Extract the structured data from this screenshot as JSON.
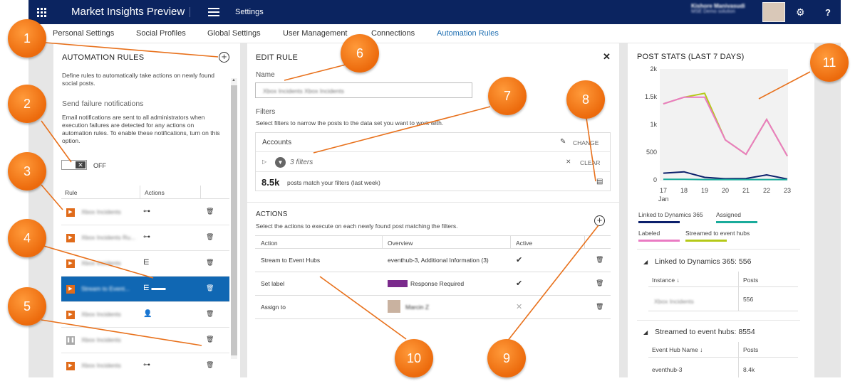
{
  "topbar": {
    "app_title": "Market Insights Preview",
    "section": "Settings",
    "user_name": "Kishore Manivasudi",
    "user_org": "MSE Demo solution"
  },
  "tabs": [
    "Personal Settings",
    "Social Profiles",
    "Global Settings",
    "User Management",
    "Connections",
    "Automation Rules"
  ],
  "automation": {
    "title": "AUTOMATION RULES",
    "description": "Define rules to automatically take actions on newly found social posts.",
    "failure_title": "Send failure notifications",
    "failure_desc": "Email notifications are sent to all administrators when execution failures are detected for any actions on automation rules. To enable these notifications, turn on this option.",
    "toggle_state": "OFF",
    "col_rule": "Rule",
    "col_actions": "Actions",
    "rules": [
      {
        "name": "Xbox Incidents",
        "action": "⊶"
      },
      {
        "name": "Xbox Incidents Ru...",
        "action": "⊶"
      },
      {
        "name": "Xbox Incidents",
        "action": "⋿"
      },
      {
        "name": "Stream to Event...",
        "action": "⋿ ▬▬"
      },
      {
        "name": "Xbox Incidents",
        "action": "👤"
      },
      {
        "name": "Xbox Incidents",
        "action": ""
      },
      {
        "name": "Xbox Incidents",
        "action": "⊶"
      }
    ]
  },
  "edit": {
    "title": "EDIT RULE",
    "name_label": "Name",
    "name_value": "Xbox Incidents Xbox Incidents",
    "filters_label": "Filters",
    "filters_desc": "Select filters to narrow the posts to the data set you want to work with.",
    "accounts": "Accounts",
    "change": "CHANGE",
    "filters_count": "3 filters",
    "clear": "CLEAR",
    "match_count": "8.5k",
    "match_text": "posts match your filters (last week)",
    "actions_title": "ACTIONS",
    "actions_desc": "Select the actions to execute on each newly found post matching the filters.",
    "col_action": "Action",
    "col_overview": "Overview",
    "col_active": "Active",
    "rows": [
      {
        "action": "Stream to Event Hubs",
        "overview": "eventhub-3, Additional Information (3)",
        "active": "✔"
      },
      {
        "action": "Set label",
        "overview": "Response Required",
        "active": "✔"
      },
      {
        "action": "Assign to",
        "overview": "Marcin Z",
        "active": "✕"
      }
    ]
  },
  "stats": {
    "title": "POST STATS (LAST 7 DAYS)",
    "yticks": [
      "2k",
      "1.5k",
      "1k",
      "500",
      "0"
    ],
    "xticks": [
      "17",
      "18",
      "19",
      "20",
      "21",
      "22",
      "23"
    ],
    "xsub": "Jan",
    "legend": [
      {
        "label": "Linked to Dynamics 365",
        "color": "#0b1f6b"
      },
      {
        "label": "Assigned",
        "color": "#1aab9b"
      },
      {
        "label": "Labeled",
        "color": "#ea7bc3"
      },
      {
        "label": "Streamed to event hubs",
        "color": "#b5c918"
      }
    ],
    "linked_title": "Linked to Dynamics 365: 556",
    "linked_col1": "Instance ↓",
    "linked_col2": "Posts",
    "linked_instance": "Xbox Incidents",
    "linked_posts": "556",
    "streamed_title": "Streamed to event hubs: 8554",
    "streamed_col1": "Event Hub Name ↓",
    "streamed_col2": "Posts",
    "streamed_name": "eventhub-3",
    "streamed_posts": "8.4k"
  },
  "chart_data": {
    "type": "line",
    "x": [
      "17 Jan",
      "18",
      "19",
      "20",
      "21",
      "22",
      "23"
    ],
    "ylim": [
      0,
      2000
    ],
    "series": [
      {
        "name": "Streamed to event hubs",
        "values": [
          1370,
          1490,
          1560,
          720,
          460,
          1090,
          430
        ]
      },
      {
        "name": "Labeled",
        "values": [
          1370,
          1490,
          1490,
          720,
          460,
          1090,
          430
        ]
      },
      {
        "name": "Linked to Dynamics 365",
        "values": [
          120,
          145,
          45,
          20,
          25,
          90,
          15
        ]
      },
      {
        "name": "Assigned",
        "values": [
          10,
          10,
          5,
          5,
          5,
          5,
          5
        ]
      }
    ]
  },
  "callouts": [
    "1",
    "2",
    "3",
    "4",
    "5",
    "6",
    "7",
    "8",
    "9",
    "10",
    "11"
  ]
}
